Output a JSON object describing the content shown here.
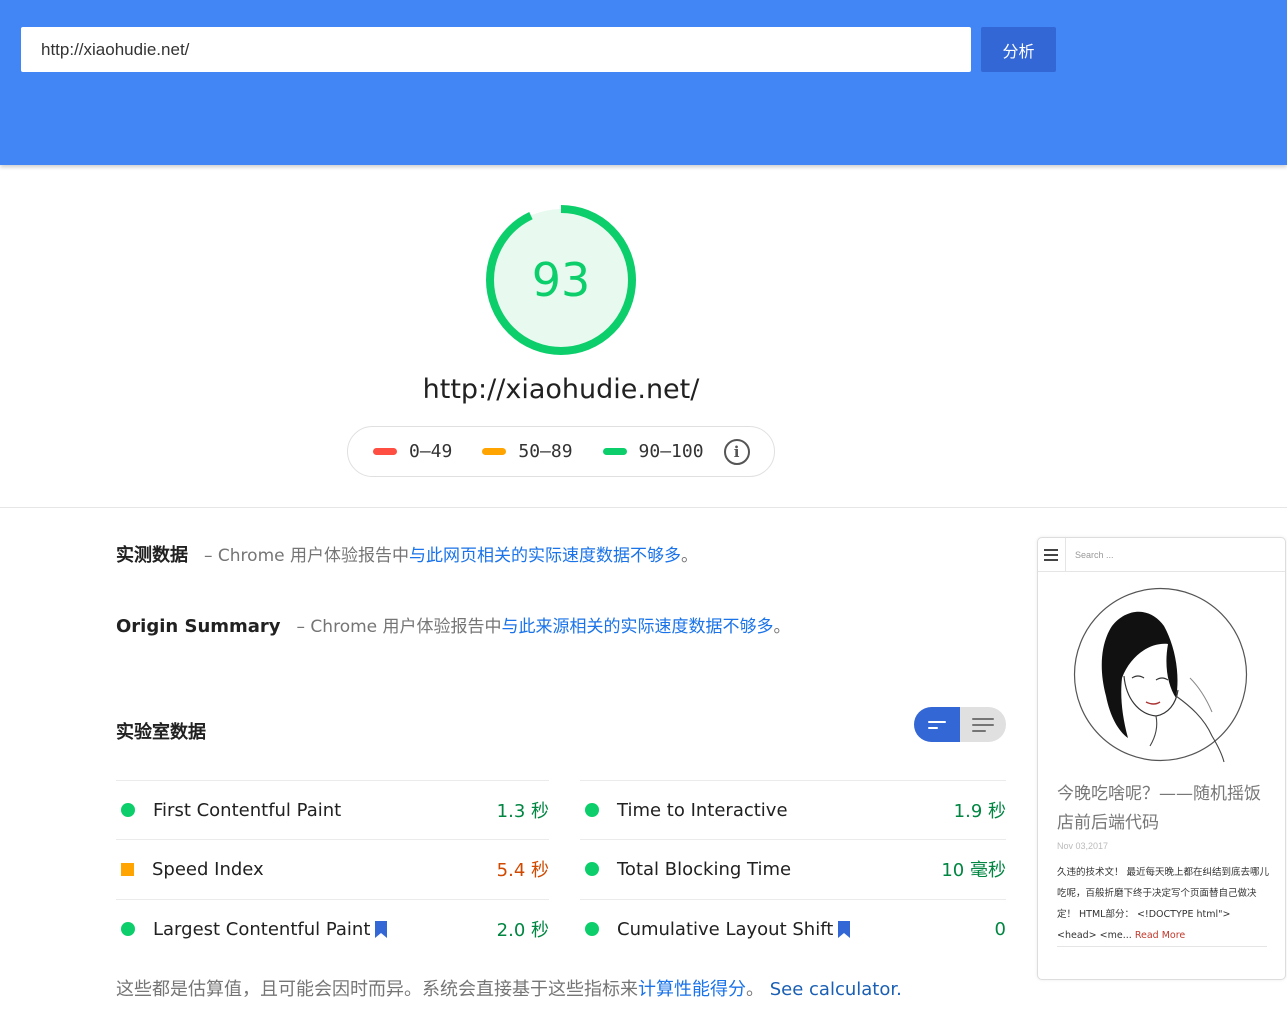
{
  "header": {
    "url_value": "http://xiaohudie.net/",
    "analyze_label": "分析",
    "background_color": "#4285f4"
  },
  "score": {
    "value": "93",
    "fraction": 0.93,
    "color": "#0cce6b",
    "url": "http://xiaohudie.net/"
  },
  "legend": {
    "items": [
      {
        "label": "0–49",
        "color": "#ff4e42"
      },
      {
        "label": "50–89",
        "color": "#ffa400"
      },
      {
        "label": "90–100",
        "color": "#0cce6b"
      }
    ],
    "info_icon": "info-icon"
  },
  "field_data": {
    "title": "实测数据",
    "desc_prefix": "– Chrome 用户体验报告中",
    "desc_link": "与此网页相关的实际速度数据不够多",
    "desc_suffix": "。"
  },
  "origin_summary": {
    "title": "Origin Summary",
    "desc_prefix": "– Chrome 用户体验报告中",
    "desc_link": "与此来源相关的实际速度数据不够多",
    "desc_suffix": "。"
  },
  "lab_data": {
    "title": "实验室数据",
    "toggle_icons": [
      "view-summary-icon",
      "view-list-icon"
    ]
  },
  "metrics": [
    {
      "name": "First Contentful Paint",
      "value": "1.3 秒",
      "status": "green",
      "bookmark": false
    },
    {
      "name": "Time to Interactive",
      "value": "1.9 秒",
      "status": "green",
      "bookmark": false
    },
    {
      "name": "Speed Index",
      "value": "5.4 秒",
      "status": "orange",
      "bookmark": false
    },
    {
      "name": "Total Blocking Time",
      "value": "10 毫秒",
      "status": "green",
      "bookmark": false
    },
    {
      "name": "Largest Contentful Paint",
      "value": "2.0 秒",
      "status": "green",
      "bookmark": true
    },
    {
      "name": "Cumulative Layout Shift",
      "value": "0",
      "status": "green",
      "bookmark": true
    }
  ],
  "footnote": {
    "prefix": "这些都是估算值，且可能会因时而异。系统会直接基于这些指标来",
    "link": "计算性能得分",
    "middle": "。",
    "calculator": "See calculator."
  },
  "screenshot": {
    "search_placeholder": "Search ...",
    "menu_icon": "hamburger-icon",
    "post_title": "今晚吃啥呢？——随机摇饭店前后端代码",
    "post_date": "Nov 03,2017",
    "excerpt": "久违的技术文！ 最近每天晚上都在纠结到底去哪儿吃呢，百般折磨下终于决定写个页面替自己做决定！ HTML部分： <!DOCTYPE html\"> <head> <me...",
    "read_more": "Read More"
  }
}
